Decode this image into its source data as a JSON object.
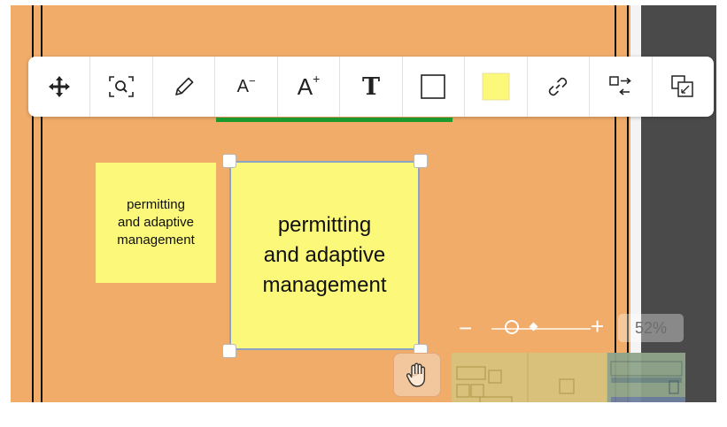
{
  "toolbar": {
    "buttons": [
      {
        "name": "move-icon"
      },
      {
        "name": "zoom-to-fit-icon"
      },
      {
        "name": "pencil-icon"
      },
      {
        "name": "decrease-font-button",
        "label": "A",
        "sup": "−"
      },
      {
        "name": "increase-font-button",
        "label": "A",
        "sup": "+"
      },
      {
        "name": "text-style-button",
        "label": "T"
      },
      {
        "name": "border-icon"
      },
      {
        "name": "fill-color-icon",
        "color": "#fbf87a"
      },
      {
        "name": "link-icon"
      },
      {
        "name": "swap-icon"
      },
      {
        "name": "layer-icon"
      }
    ],
    "active_color": "#1d9a2d"
  },
  "notes": {
    "small_text": "permitting\nand adaptive\nmanagement",
    "selected_text": "permitting\nand adaptive\nmanagement",
    "color": "#fbf87a"
  },
  "zoom": {
    "minus": "−",
    "plus": "+",
    "percent": "52%"
  },
  "colors": {
    "canvas": "#f1ac69",
    "side_panel": "#4a4a4a"
  }
}
